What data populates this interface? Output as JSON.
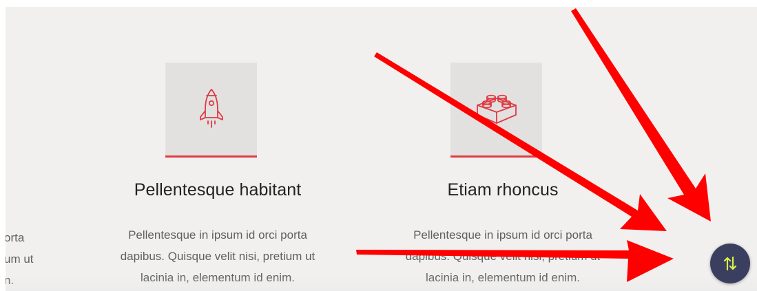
{
  "partial_card": {
    "lines": [
      "orta",
      "um ut",
      "n."
    ]
  },
  "cards": [
    {
      "icon": "rocket-icon",
      "title": "Pellentesque habitant",
      "lines": [
        "Pellentesque in ipsum id orci porta",
        "dapibus. Quisque velit nisi, pretium ut",
        "lacinia in, elementum id enim."
      ]
    },
    {
      "icon": "lego-brick-icon",
      "title": "Etiam rhoncus",
      "lines": [
        "Pellentesque in ipsum id orci porta",
        "dapibus. Quisque velit nisi, pretium ut",
        "lacinia in, elementum id enim."
      ]
    }
  ],
  "scroll_button": {
    "icon": "up-down-arrows-icon"
  },
  "colors": {
    "background": "#f1f0ef",
    "accent": "#e03a43",
    "icon_box": "#e2e1e0",
    "button": "#3b3f5f",
    "button_icon": "#d7f04a",
    "annotation_arrow": "#ff0000"
  }
}
